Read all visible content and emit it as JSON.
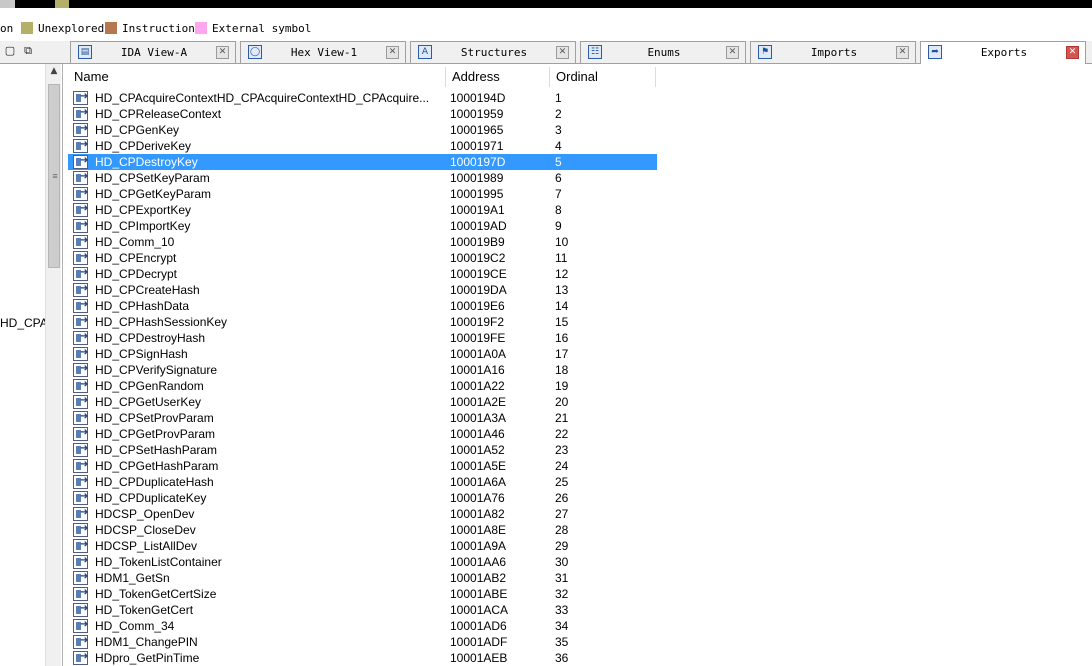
{
  "legend": [
    {
      "label": "on",
      "color": null
    },
    {
      "label": "Unexplored",
      "color": "#b4b06a"
    },
    {
      "label": "Instruction",
      "color": "#b5784e"
    },
    {
      "label": "External symbol",
      "color": "#ffa6f0"
    }
  ],
  "left_toolbar": {
    "restore_icon": "▢",
    "float_icon": "⧉"
  },
  "tabs": [
    {
      "label": "IDA View-A",
      "icon": "▤",
      "close": "✕",
      "active": false
    },
    {
      "label": "Hex View-1",
      "icon": "◯",
      "close": "✕",
      "active": false
    },
    {
      "label": "Structures",
      "icon": "A",
      "close": "✕",
      "active": false
    },
    {
      "label": "Enums",
      "icon": "☷",
      "close": "✕",
      "active": false
    },
    {
      "label": "Imports",
      "icon": "⚑",
      "close": "✕",
      "active": false
    },
    {
      "label": "Exports",
      "icon": "➦",
      "close": "✕",
      "active": true
    }
  ],
  "left_pane": {
    "label": "HD_CPA",
    "scroll_up": "▲",
    "grip": "≡"
  },
  "table": {
    "columns": [
      "Name",
      "Address",
      "Ordinal"
    ],
    "selected_index": 4,
    "rows": [
      {
        "name": "HD_CPAcquireContextHD_CPAcquireContextHD_CPAcquire...",
        "address": "1000194D",
        "ordinal": "1"
      },
      {
        "name": "HD_CPReleaseContext",
        "address": "10001959",
        "ordinal": "2"
      },
      {
        "name": "HD_CPGenKey",
        "address": "10001965",
        "ordinal": "3"
      },
      {
        "name": "HD_CPDeriveKey",
        "address": "10001971",
        "ordinal": "4"
      },
      {
        "name": "HD_CPDestroyKey",
        "address": "1000197D",
        "ordinal": "5"
      },
      {
        "name": "HD_CPSetKeyParam",
        "address": "10001989",
        "ordinal": "6"
      },
      {
        "name": "HD_CPGetKeyParam",
        "address": "10001995",
        "ordinal": "7"
      },
      {
        "name": "HD_CPExportKey",
        "address": "100019A1",
        "ordinal": "8"
      },
      {
        "name": "HD_CPImportKey",
        "address": "100019AD",
        "ordinal": "9"
      },
      {
        "name": "HD_Comm_10",
        "address": "100019B9",
        "ordinal": "10"
      },
      {
        "name": "HD_CPEncrypt",
        "address": "100019C2",
        "ordinal": "11"
      },
      {
        "name": "HD_CPDecrypt",
        "address": "100019CE",
        "ordinal": "12"
      },
      {
        "name": "HD_CPCreateHash",
        "address": "100019DA",
        "ordinal": "13"
      },
      {
        "name": "HD_CPHashData",
        "address": "100019E6",
        "ordinal": "14"
      },
      {
        "name": "HD_CPHashSessionKey",
        "address": "100019F2",
        "ordinal": "15"
      },
      {
        "name": "HD_CPDestroyHash",
        "address": "100019FE",
        "ordinal": "16"
      },
      {
        "name": "HD_CPSignHash",
        "address": "10001A0A",
        "ordinal": "17"
      },
      {
        "name": "HD_CPVerifySignature",
        "address": "10001A16",
        "ordinal": "18"
      },
      {
        "name": "HD_CPGenRandom",
        "address": "10001A22",
        "ordinal": "19"
      },
      {
        "name": "HD_CPGetUserKey",
        "address": "10001A2E",
        "ordinal": "20"
      },
      {
        "name": "HD_CPSetProvParam",
        "address": "10001A3A",
        "ordinal": "21"
      },
      {
        "name": "HD_CPGetProvParam",
        "address": "10001A46",
        "ordinal": "22"
      },
      {
        "name": "HD_CPSetHashParam",
        "address": "10001A52",
        "ordinal": "23"
      },
      {
        "name": "HD_CPGetHashParam",
        "address": "10001A5E",
        "ordinal": "24"
      },
      {
        "name": "HD_CPDuplicateHash",
        "address": "10001A6A",
        "ordinal": "25"
      },
      {
        "name": "HD_CPDuplicateKey",
        "address": "10001A76",
        "ordinal": "26"
      },
      {
        "name": "HDCSP_OpenDev",
        "address": "10001A82",
        "ordinal": "27"
      },
      {
        "name": "HDCSP_CloseDev",
        "address": "10001A8E",
        "ordinal": "28"
      },
      {
        "name": "HDCSP_ListAllDev",
        "address": "10001A9A",
        "ordinal": "29"
      },
      {
        "name": "HD_TokenListContainer",
        "address": "10001AA6",
        "ordinal": "30"
      },
      {
        "name": "HDM1_GetSn",
        "address": "10001AB2",
        "ordinal": "31"
      },
      {
        "name": "HD_TokenGetCertSize",
        "address": "10001ABE",
        "ordinal": "32"
      },
      {
        "name": "HD_TokenGetCert",
        "address": "10001ACA",
        "ordinal": "33"
      },
      {
        "name": "HD_Comm_34",
        "address": "10001AD6",
        "ordinal": "34"
      },
      {
        "name": "HDM1_ChangePIN",
        "address": "10001ADF",
        "ordinal": "35"
      },
      {
        "name": "HDpro_GetPinTime",
        "address": "10001AEB",
        "ordinal": "36"
      }
    ]
  }
}
